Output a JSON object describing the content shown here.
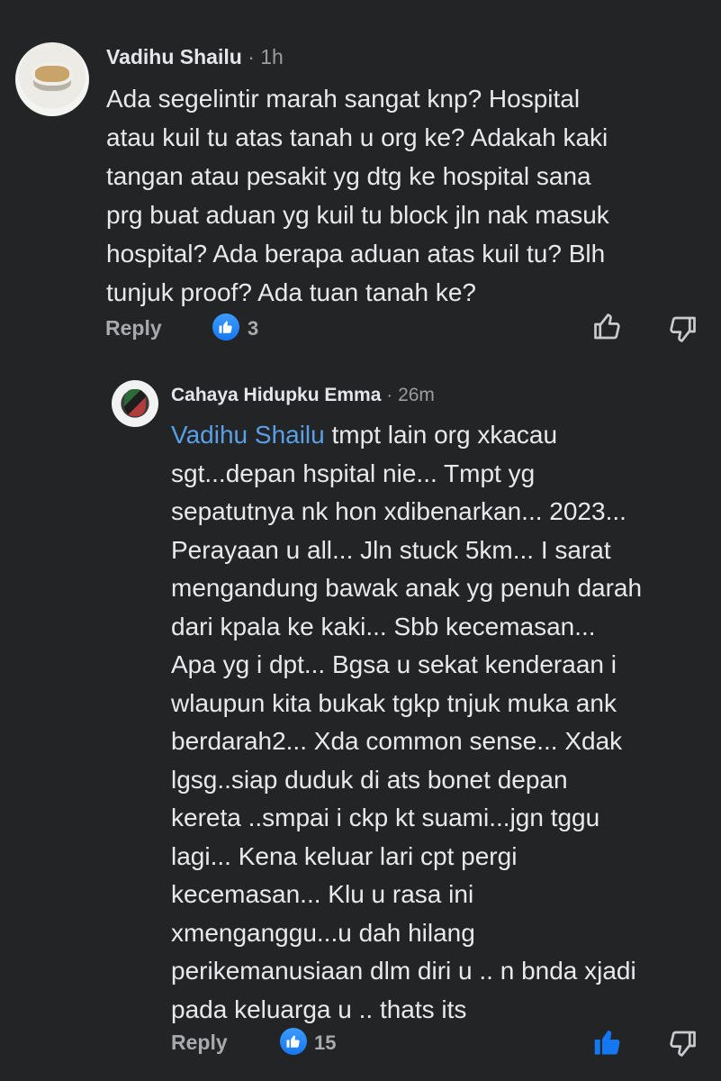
{
  "comments": [
    {
      "author": "Vadihu Shailu",
      "time": " · 1h",
      "text": "Ada segelintir marah sangat knp? Hospital\natau kuil tu atas tanah u org ke? Adakah kaki\ntangan atau pesakit yg dtg ke hospital sana\nprg buat aduan yg kuil tu block jln nak masuk\nhospital? Ada berapa aduan atas kuil tu? Blh\ntunjuk proof? Ada tuan tanah ke?",
      "reply_label": "Reply",
      "reaction_count": "3",
      "reaction_icon": "like-icon",
      "liked": false
    },
    {
      "author": "Cahaya Hidupku Emma",
      "time": " · 26m",
      "mention": "Vadihu Shailu",
      "text": " tmpt lain org xkacau\nsgt...depan hspital nie... Tmpt yg\nsepatutnya nk hon xdibenarkan... 2023...\nPerayaan u all... Jln stuck 5km... I sarat\nmengandung bawak anak yg penuh darah\ndari kpala ke kaki... Sbb kecemasan...\nApa yg i dpt... Bgsa u sekat kenderaan i\nwlaupun kita bukak tgkp tnjuk muka ank\nberdarah2... Xda common sense... Xdak\nlgsg..siap duduk di ats bonet depan\nkereta ..smpai i ckp kt suami...jgn tggu\nlagi... Kena keluar lari cpt pergi\nkecemasan... Klu u rasa ini\nxmenganggu...u dah hilang\nperikemanusiaan dlm diri u .. n bnda xjadi\npada keluarga u .. thats its",
      "reply_label": "Reply",
      "reaction_count": "15",
      "reaction_icon": "like-icon",
      "liked": true
    }
  ],
  "colors": {
    "background": "#222426",
    "mention": "#5b9fe6",
    "like_blue": "#1677f2",
    "muted": "#a8aaae"
  }
}
